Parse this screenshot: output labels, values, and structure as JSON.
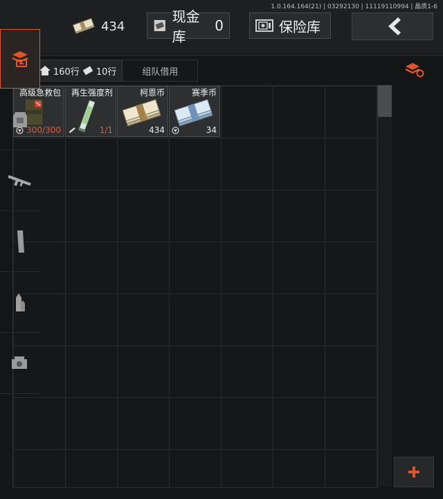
{
  "header": {
    "version": "1.0.164.164(21) | 03292130 | 11119110994 | 晶质1-6",
    "cash_value": "434",
    "cash_vault_label": "现金库",
    "cash_vault_count": "0",
    "safe_label": "保险库"
  },
  "tabs": {
    "warehouse": "仓库",
    "home_rows": "160行",
    "extra_rows": "10行",
    "team_loan": "组队借用"
  },
  "items": [
    {
      "name": "高级急救包",
      "count": "300/300",
      "icon": "first-aid-kit-icon"
    },
    {
      "name": "再生强度剂",
      "count": "1/1",
      "icon": "syringe-icon"
    },
    {
      "name": "柯恩币",
      "count": "434",
      "icon": "koen-coin-stack-icon"
    },
    {
      "name": "赛季币",
      "count": "34",
      "icon": "season-coin-stack-icon"
    }
  ],
  "sidebar": [
    "stack-refresh-icon",
    "warehouse-icon",
    "armor-icon",
    "rifle-icon",
    "magazine-icon",
    "ammo-icon",
    "scope-icon",
    "add-icon"
  ],
  "colors": {
    "accent": "#e0552c",
    "danger": "#e05a3a"
  }
}
